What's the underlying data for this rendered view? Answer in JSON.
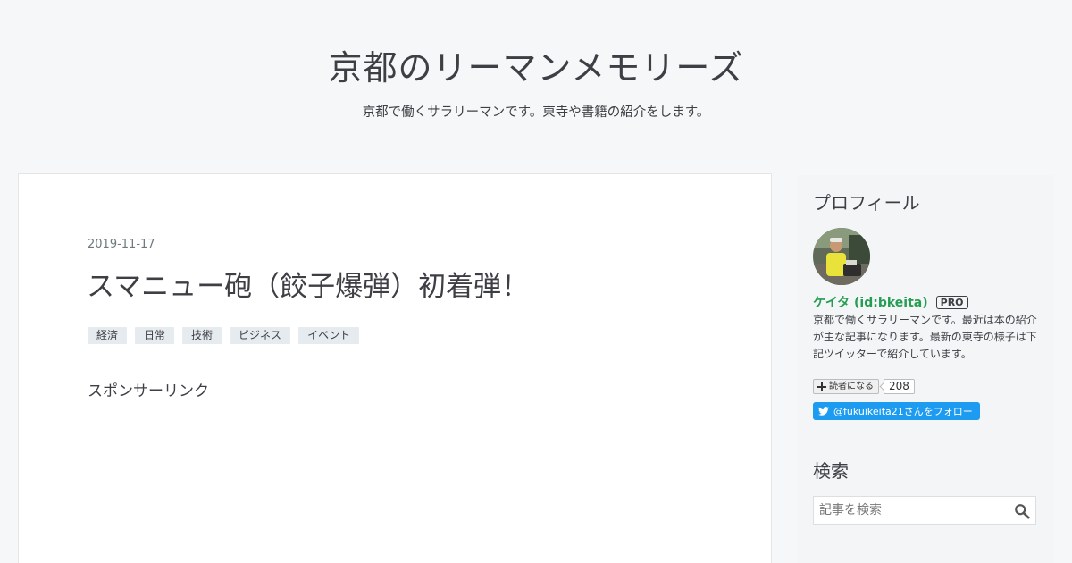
{
  "blog": {
    "title": "京都のリーマンメモリーズ",
    "description": "京都で働くサラリーマンです。東寺や書籍の紹介をします。"
  },
  "entry": {
    "date": "2019-11-17",
    "title": "スマニュー砲（餃子爆弾）初着弾！",
    "categories": [
      "経済",
      "日常",
      "技術",
      "ビジネス",
      "イベント"
    ],
    "sponsor_label": "スポンサーリンク"
  },
  "sidebar": {
    "profile": {
      "heading": "プロフィール",
      "name": "ケイタ (id:bkeita)",
      "badge": "PRO",
      "description": "京都で働くサラリーマンです。最近は本の紹介が主な記事になります。最新の東寺の様子は下記ツイッターで紹介しています。",
      "subscribe_label": "読者になる",
      "subscriber_count": "208",
      "twitter_label": "@fukuikeita21さんをフォロー"
    },
    "search": {
      "heading": "検索",
      "placeholder": "記事を検索"
    }
  },
  "colors": {
    "background": "#f6f7f8",
    "accent_green": "#259d52",
    "twitter_blue": "#1d9bf0",
    "category_bg": "#e5ebef"
  },
  "icons": [
    "plus-icon",
    "twitter-bird-icon",
    "search-icon"
  ]
}
